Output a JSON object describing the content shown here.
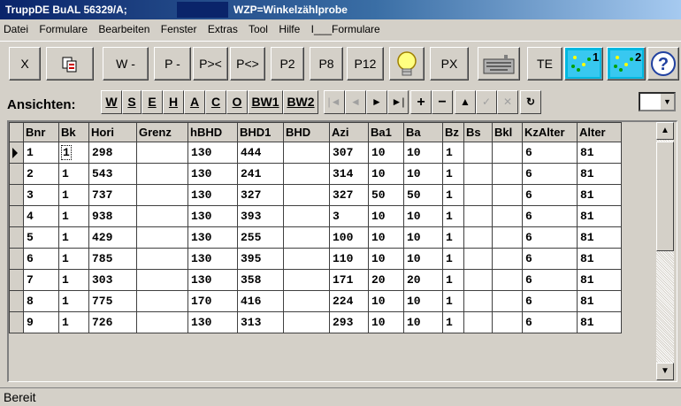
{
  "window": {
    "title_left": "TruppDE BuAL  56329/A;",
    "title_right": "WZP=Winkelzählprobe"
  },
  "menu": [
    "Datei",
    "Formulare",
    "Bearbeiten",
    "Fenster",
    "Extras",
    "Tool",
    "Hilfe",
    "I___Formulare"
  ],
  "toolbar": {
    "close": "X",
    "w_minus": "W -",
    "p_minus": "P -",
    "p_join": "P><",
    "p_split": "P<>",
    "p2": "P2",
    "p8": "P8",
    "p12": "P12",
    "px": "PX",
    "te": "TE",
    "help": "?",
    "map1_badge": "1",
    "map2_badge": "2"
  },
  "views": {
    "label": "Ansichten:",
    "buttons": [
      "W",
      "S",
      "E",
      "H",
      "A",
      "C",
      "O",
      "BW1",
      "BW2"
    ],
    "nav": [
      "|◄",
      "◄",
      "►",
      "►|",
      "+",
      "−",
      "▲",
      "✓",
      "✕",
      "↻"
    ]
  },
  "grid": {
    "columns": [
      "Bnr",
      "Bk",
      "Hori",
      "Grenz",
      "hBHD",
      "BHD1",
      "BHD",
      "Azi",
      "Ba1",
      "Ba",
      "Bz",
      "Bs",
      "Bkl",
      "KzAlter",
      "Alter"
    ],
    "rows": [
      [
        "1",
        "1",
        "298",
        "",
        "130",
        "444",
        "",
        "307",
        "10",
        "10",
        "1",
        "",
        "",
        "6",
        "81"
      ],
      [
        "2",
        "1",
        "543",
        "",
        "130",
        "241",
        "",
        "314",
        "10",
        "10",
        "1",
        "",
        "",
        "6",
        "81"
      ],
      [
        "3",
        "1",
        "737",
        "",
        "130",
        "327",
        "",
        "327",
        "50",
        "50",
        "1",
        "",
        "",
        "6",
        "81"
      ],
      [
        "4",
        "1",
        "938",
        "",
        "130",
        "393",
        "",
        "3",
        "10",
        "10",
        "1",
        "",
        "",
        "6",
        "81"
      ],
      [
        "5",
        "1",
        "429",
        "",
        "130",
        "255",
        "",
        "100",
        "10",
        "10",
        "1",
        "",
        "",
        "6",
        "81"
      ],
      [
        "6",
        "1",
        "785",
        "",
        "130",
        "395",
        "",
        "110",
        "10",
        "10",
        "1",
        "",
        "",
        "6",
        "81"
      ],
      [
        "7",
        "1",
        "303",
        "",
        "130",
        "358",
        "",
        "171",
        "20",
        "20",
        "1",
        "",
        "",
        "6",
        "81"
      ],
      [
        "8",
        "1",
        "775",
        "",
        "170",
        "416",
        "",
        "224",
        "10",
        "10",
        "1",
        "",
        "",
        "6",
        "81"
      ],
      [
        "9",
        "1",
        "726",
        "",
        "130",
        "313",
        "",
        "293",
        "10",
        "10",
        "1",
        "",
        "",
        "6",
        "81"
      ]
    ]
  },
  "status": "Bereit"
}
